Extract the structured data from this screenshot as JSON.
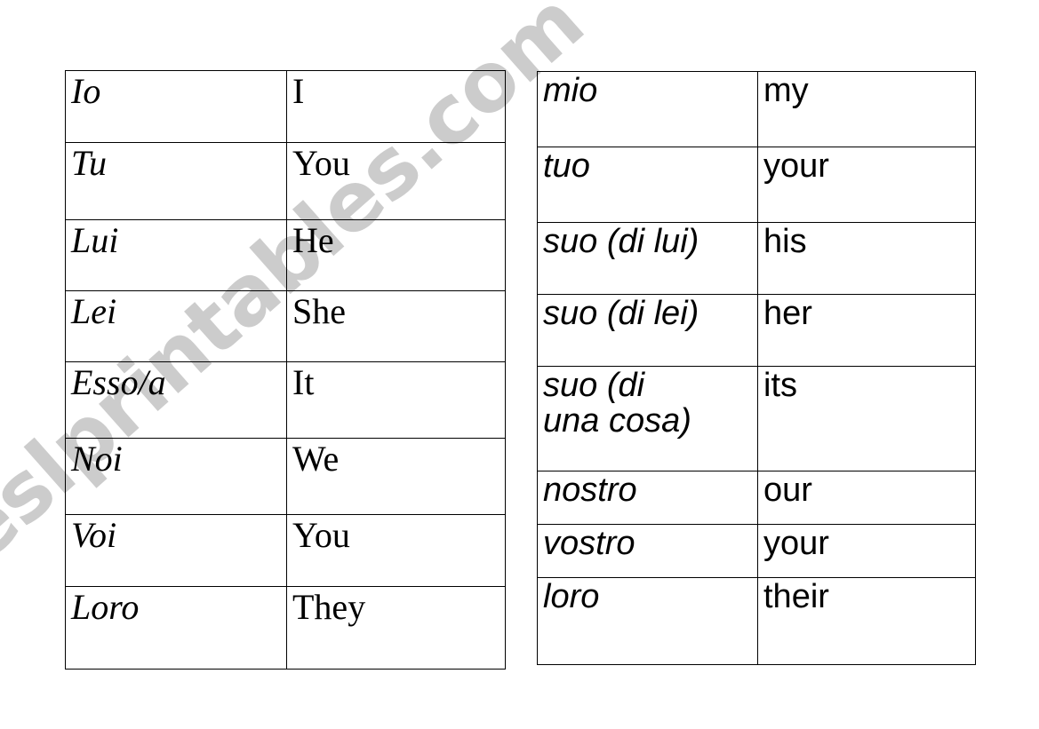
{
  "page": {
    "background_color": "#ffffff",
    "text_color": "#000000"
  },
  "watermark": {
    "text": "eslprintables.com",
    "color": "#cccccc",
    "rotation_degrees": -41.5
  },
  "tables": {
    "pronouns": {
      "name": "subject-pronouns-table",
      "rows": [
        {
          "source": "Io",
          "target": "I"
        },
        {
          "source": "Tu",
          "target": "You"
        },
        {
          "source": "Lui",
          "target": "He"
        },
        {
          "source": "Lei",
          "target": "She"
        },
        {
          "source": "Esso/a",
          "target": "It"
        },
        {
          "source": "Noi",
          "target": "We"
        },
        {
          "source": "Voi",
          "target": "You"
        },
        {
          "source": "Loro",
          "target": "They"
        }
      ]
    },
    "possessives": {
      "name": "possessive-adjectives-table",
      "rows": [
        {
          "source": "mio",
          "source_line2": "",
          "target": "my"
        },
        {
          "source": "tuo",
          "source_line2": "",
          "target": "your"
        },
        {
          "source": "suo (di lui)",
          "source_line2": "",
          "target": "his"
        },
        {
          "source": "suo (di lei)",
          "source_line2": "",
          "target": "her"
        },
        {
          "source": "suo (di",
          "source_line2": "una cosa)",
          "target": "its"
        },
        {
          "source": "nostro",
          "source_line2": "",
          "target": "our"
        },
        {
          "source": "vostro",
          "source_line2": "",
          "target": "your"
        },
        {
          "source": "loro",
          "source_line2": "",
          "target": "their"
        }
      ]
    }
  }
}
